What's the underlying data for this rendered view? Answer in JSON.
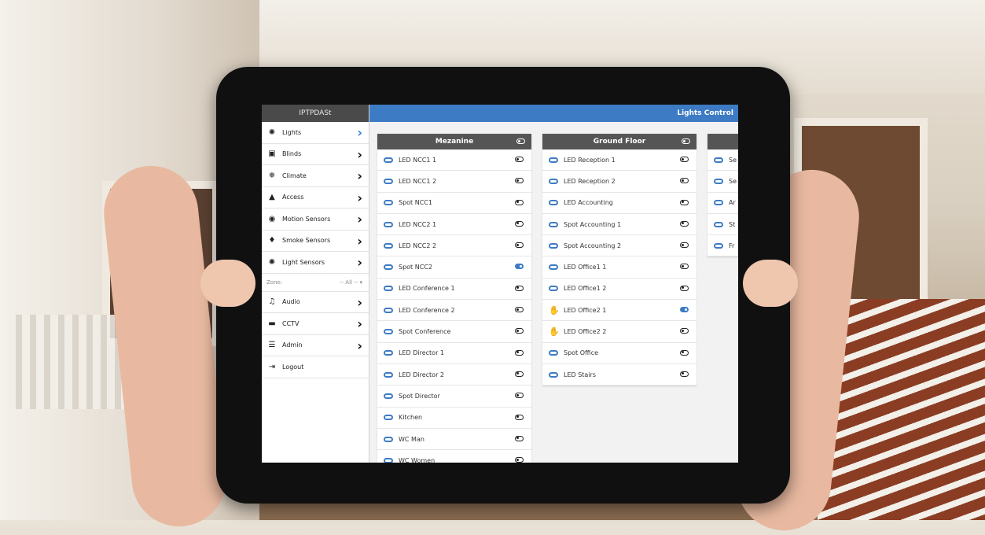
{
  "app": {
    "sidebar_title": "IPTPDASt",
    "page_title": "Lights Control"
  },
  "sidebar": {
    "items": [
      {
        "label": "Lights",
        "icon": "bulb-icon",
        "active": true
      },
      {
        "label": "Blinds",
        "icon": "image-icon"
      },
      {
        "label": "Climate",
        "icon": "snowflake-icon"
      },
      {
        "label": "Access",
        "icon": "lock-icon"
      },
      {
        "label": "Motion Sensors",
        "icon": "eye-icon"
      },
      {
        "label": "Smoke Sensors",
        "icon": "flame-icon"
      },
      {
        "label": "Light Sensors",
        "icon": "bulb-icon"
      }
    ],
    "zone_label": "Zone:",
    "zone_value": "-- All --",
    "items2": [
      {
        "label": "Audio",
        "icon": "music-icon"
      },
      {
        "label": "CCTV",
        "icon": "camera-icon"
      },
      {
        "label": "Admin",
        "icon": "sliders-icon"
      },
      {
        "label": "Logout",
        "icon": "logout-icon"
      }
    ]
  },
  "panels": [
    {
      "title": "Mezanine",
      "rows": [
        {
          "label": "LED NCC1 1",
          "on": false,
          "manual": false
        },
        {
          "label": "LED NCC1 2",
          "on": false,
          "manual": false
        },
        {
          "label": "Spot NCC1",
          "on": false,
          "manual": false
        },
        {
          "label": "LED NCC2 1",
          "on": false,
          "manual": false
        },
        {
          "label": "LED NCC2 2",
          "on": false,
          "manual": false
        },
        {
          "label": "Spot NCC2",
          "on": true,
          "manual": false
        },
        {
          "label": "LED Conference 1",
          "on": false,
          "manual": false
        },
        {
          "label": "LED Conference 2",
          "on": false,
          "manual": false
        },
        {
          "label": "Spot Conference",
          "on": false,
          "manual": false
        },
        {
          "label": "LED Director 1",
          "on": false,
          "manual": false
        },
        {
          "label": "LED Director 2",
          "on": false,
          "manual": false
        },
        {
          "label": "Spot Director",
          "on": false,
          "manual": false
        },
        {
          "label": "Kitchen",
          "on": false,
          "manual": false
        },
        {
          "label": "WC Man",
          "on": false,
          "manual": false
        },
        {
          "label": "WC Women",
          "on": false,
          "manual": false
        }
      ]
    },
    {
      "title": "Ground Floor",
      "rows": [
        {
          "label": "LED Reception 1",
          "on": false,
          "manual": false
        },
        {
          "label": "LED Reception 2",
          "on": false,
          "manual": false
        },
        {
          "label": "LED Accounting",
          "on": false,
          "manual": false
        },
        {
          "label": "Spot Accounting 1",
          "on": false,
          "manual": false
        },
        {
          "label": "Spot Accounting 2",
          "on": false,
          "manual": false
        },
        {
          "label": "LED Office1 1",
          "on": false,
          "manual": false
        },
        {
          "label": "LED Office1 2",
          "on": false,
          "manual": false
        },
        {
          "label": "LED Office2 1",
          "on": true,
          "manual": true
        },
        {
          "label": "LED Office2 2",
          "on": false,
          "manual": true
        },
        {
          "label": "Spot Office",
          "on": false,
          "manual": false
        },
        {
          "label": "LED Stairs",
          "on": false,
          "manual": false
        }
      ]
    },
    {
      "title": "",
      "rows": [
        {
          "label": "Se",
          "on": false,
          "manual": false
        },
        {
          "label": "Se",
          "on": false,
          "manual": false
        },
        {
          "label": "Ar",
          "on": false,
          "manual": false
        },
        {
          "label": "St",
          "on": false,
          "manual": false
        },
        {
          "label": "Fr",
          "on": false,
          "manual": false
        }
      ]
    }
  ],
  "colors": {
    "accent": "#3d7bc4",
    "header": "#555555",
    "manual": "#e4572e"
  }
}
